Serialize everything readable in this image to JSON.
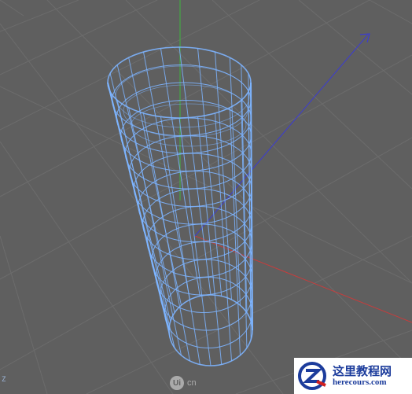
{
  "viewport": {
    "background_color": "#5f5f5f",
    "grid_color": "#6c6c6c",
    "mesh_color": "#7db4ff",
    "axis_colors": {
      "x": "#c83c3c",
      "y": "#3fb43f",
      "z": "#3c3cd0"
    },
    "object": "cylinder-wireframe",
    "axis_indicator": "Z"
  },
  "center_logo": {
    "badge": "Ui",
    "suffix": "cn"
  },
  "watermark": {
    "title": "这里教程网",
    "url": "herecours.com",
    "badge_icon": "z-logo-icon",
    "colors": {
      "text": "#1c3c9c",
      "badge_blue": "#1c3c9c",
      "badge_red": "#d02020"
    }
  }
}
